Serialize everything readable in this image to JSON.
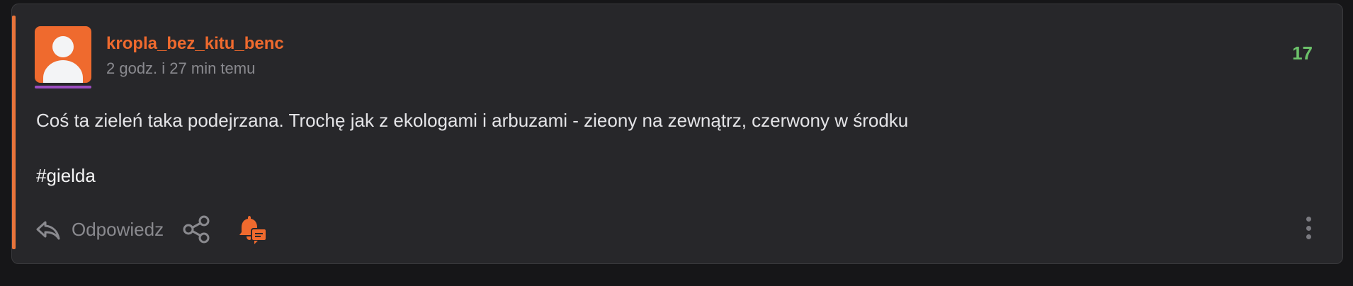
{
  "post": {
    "author": "kropla_bez_kitu_benc",
    "time": "2 godz. i 27 min temu",
    "score": "17",
    "body": "Coś ta zieleń taka podejrzana. Trochę jak z ekologami i arbuzami - zieony na zewnątrz, czerwony w środku",
    "tag": "#gielda"
  },
  "actions": {
    "reply_label": "Odpowiedz",
    "icons": [
      "reply-icon",
      "share-icon",
      "bell-comment-icon",
      "more-vertical-icon"
    ]
  },
  "colors": {
    "accent": "#ef6a2e",
    "score": "#6cc26a",
    "avatar_underline": "#9b4dc0",
    "card_bg": "#27272a",
    "page_bg": "#161618"
  }
}
